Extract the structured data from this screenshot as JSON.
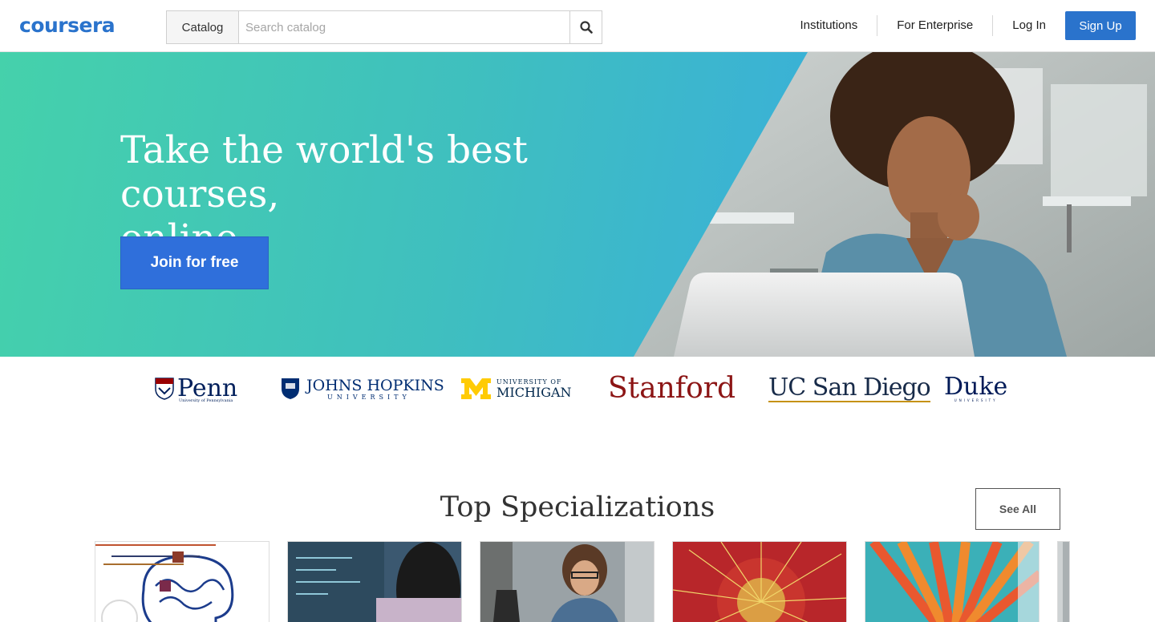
{
  "header": {
    "logo_text": "coursera",
    "catalog_label": "Catalog",
    "search_placeholder": "Search catalog",
    "search_icon": "search-icon",
    "nav": {
      "institutions": "Institutions",
      "enterprise": "For Enterprise",
      "login": "Log In",
      "signup": "Sign Up"
    }
  },
  "hero": {
    "title_line1": "Take the world's best courses,",
    "title_line2": "online.",
    "cta": "Join for free"
  },
  "partners": {
    "penn": {
      "name": "Penn",
      "subtitle": "University of Pennsylvania"
    },
    "jhu": {
      "name": "JOHNS HOPKINS",
      "subtitle": "UNIVERSITY"
    },
    "umich": {
      "subtitle": "UNIVERSITY OF",
      "name": "MICHIGAN"
    },
    "stanford": {
      "name": "Stanford"
    },
    "ucsd": {
      "name": "UC San Diego"
    },
    "duke": {
      "name": "Duke",
      "subtitle": "UNIVERSITY"
    }
  },
  "specializations": {
    "title": "Top Specializations",
    "see_all": "See All"
  },
  "colors": {
    "brand": "#2a73cc",
    "hero_start": "#45d1ab",
    "hero_end": "#39aedc",
    "join_button": "#2f6fdb"
  }
}
